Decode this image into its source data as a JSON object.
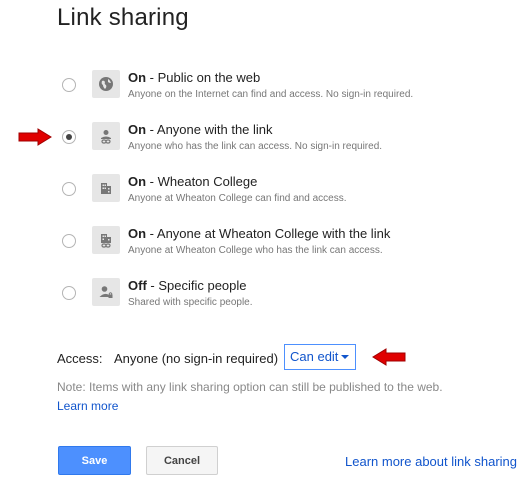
{
  "dialog": {
    "title": "Link sharing"
  },
  "options": [
    {
      "state": "On",
      "label": " - Public on the web",
      "description": "Anyone on the Internet can find and access. No sign-in required.",
      "icon": "globe-icon",
      "selected": false
    },
    {
      "state": "On",
      "label": " - Anyone with the link",
      "description": "Anyone who has the link can access. No sign-in required.",
      "icon": "person-link-icon",
      "selected": true
    },
    {
      "state": "On",
      "label": " - Wheaton College",
      "description": "Anyone at Wheaton College can find and access.",
      "icon": "building-icon",
      "selected": false
    },
    {
      "state": "On",
      "label": " - Anyone at Wheaton College with the link",
      "description": "Anyone at Wheaton College who has the link can access.",
      "icon": "building-link-icon",
      "selected": false
    },
    {
      "state": "Off",
      "label": " - Specific people",
      "description": "Shared with specific people.",
      "icon": "person-lock-icon",
      "selected": false
    }
  ],
  "access": {
    "label": "Access:",
    "value": "Anyone (no sign-in required)",
    "permission": "Can edit"
  },
  "note": "Note: Items with any link sharing option can still be published to the web.",
  "learn_more": "Learn more",
  "buttons": {
    "save": "Save",
    "cancel": "Cancel"
  },
  "learn_more_sharing": "Learn more about link sharing",
  "colors": {
    "accent": "#4d90fe",
    "link": "#1155cc",
    "arrow": "#e00000"
  }
}
